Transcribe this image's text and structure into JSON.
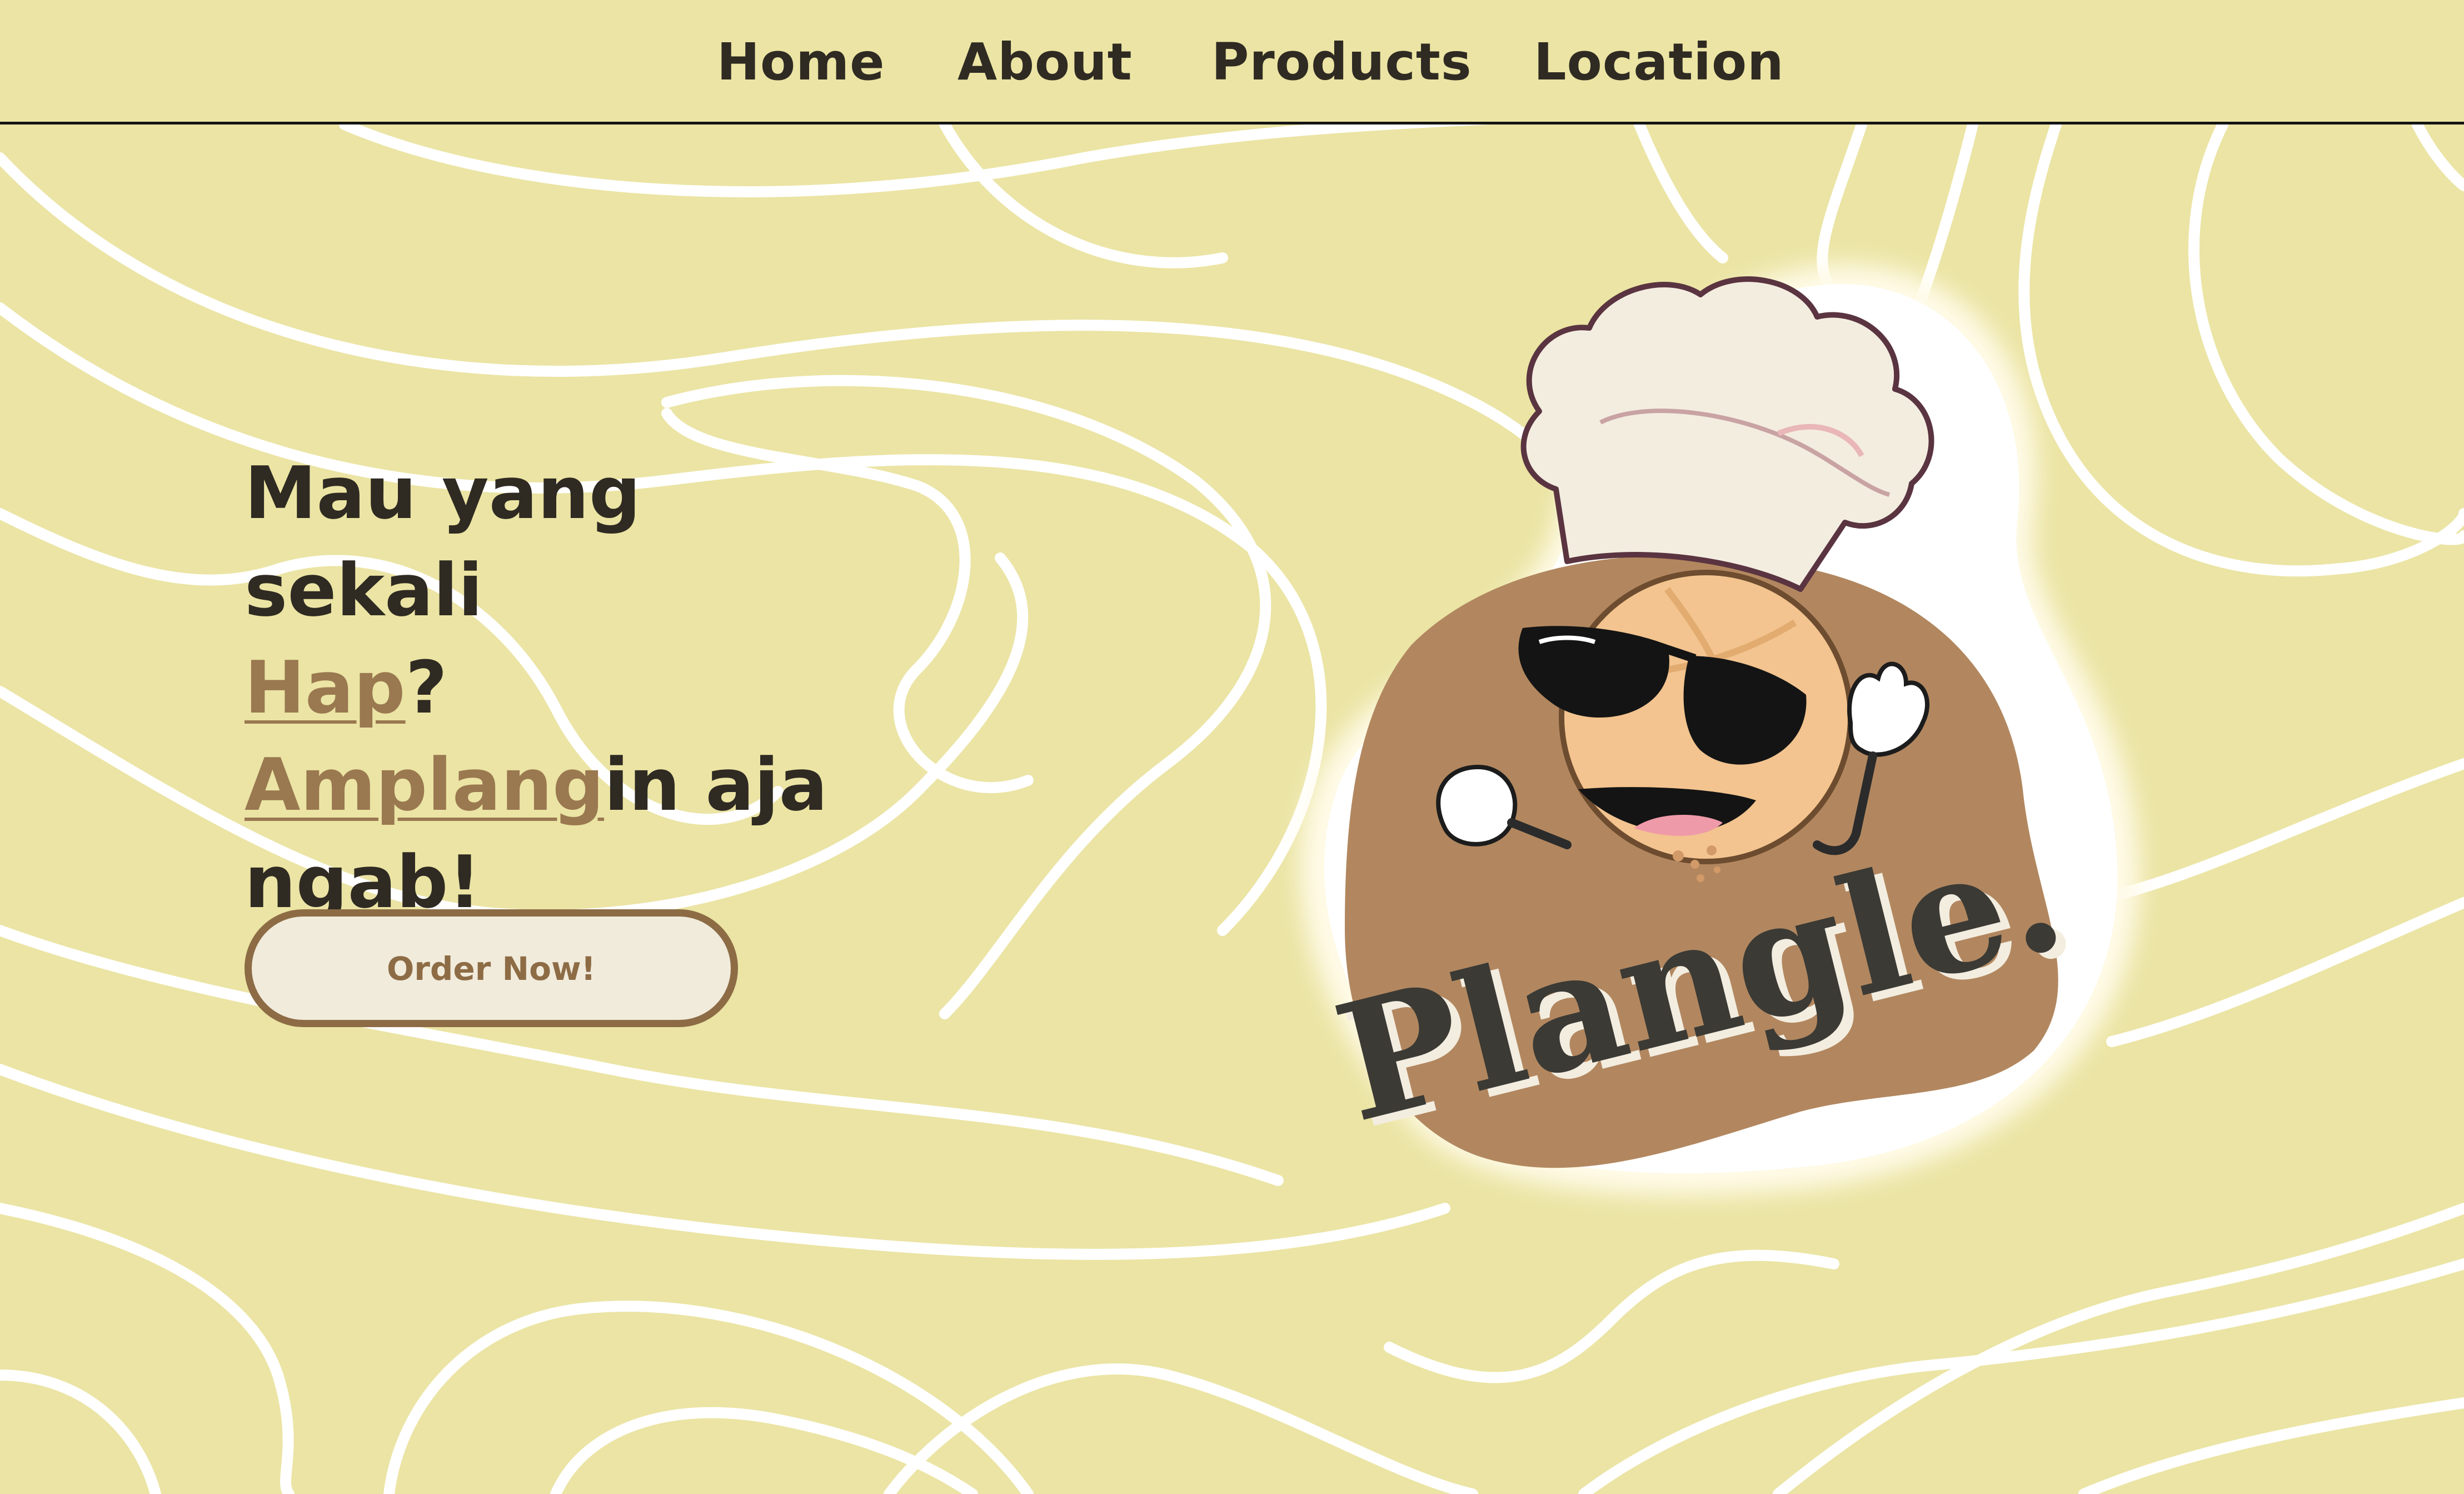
{
  "nav": {
    "items": [
      {
        "label": "Home"
      },
      {
        "label": "About"
      },
      {
        "label": "Products"
      },
      {
        "label": "Location"
      }
    ]
  },
  "hero": {
    "line1": "Mau yang sekali",
    "hap": "Hap",
    "question": "?",
    "amplang": "Amplang",
    "in_aja": "in aja",
    "line4": "ngab!",
    "order_button": "Order Now!"
  },
  "logo": {
    "wordmark": "Plangle."
  },
  "colors": {
    "background": "#ebe4a4",
    "text": "#2f2a22",
    "accent": "#9a7850",
    "button_bg": "#f1ebdc",
    "button_border": "#8d6c45"
  }
}
